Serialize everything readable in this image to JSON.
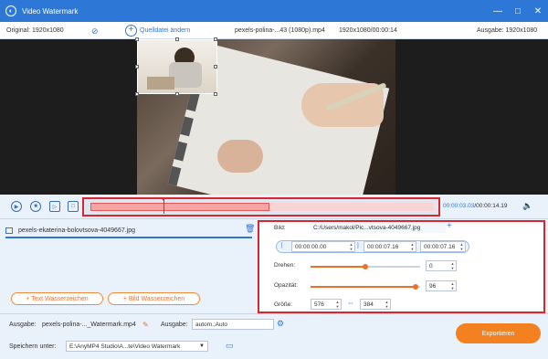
{
  "window": {
    "title": "Video Watermark",
    "controls": [
      "—",
      "□",
      "✕"
    ]
  },
  "info": {
    "original": "Original: 1920x1080",
    "change_source": "Quelldatei ändern",
    "filename": "pexels-polina-...43 (1080p).mp4",
    "res_time": "1920x1080/00:00:14",
    "output": "Ausgabe: 1920x1080"
  },
  "timeline": {
    "current": "00:00:03.03",
    "total": "/00:00:14.19"
  },
  "watermark_list": {
    "items": [
      {
        "name": "pexels-ekaterina-bolovtsova-4049667.jpg"
      }
    ],
    "text_btn": "+ Text Wasserzeichen",
    "image_btn": "+ Bild Wasserzeichen"
  },
  "props": {
    "image_label": "Bild:",
    "image_path": "C:/Users/makol/Pic...vtsova-4049667.jpg",
    "start": "00:00:00.00",
    "end": "00:00:07.16",
    "duration": "00:00:07.16",
    "rotate_label": "Drehen:",
    "rotate_value": "0",
    "rotate_fraction": 0.5,
    "opacity_label": "Opazität:",
    "opacity_value": "96",
    "opacity_fraction": 0.96,
    "size_label": "Größe:",
    "width": "576",
    "height": "384"
  },
  "footer": {
    "output_label": "Ausgabe:",
    "output_value": "pexels-polina-..._Watermark.mp4",
    "output2_label": "Ausgabe:",
    "output2_value": "autom.;Auto",
    "save_label": "Speichern unter:",
    "save_path": "E:\\AnyMP4 Studio\\A...te\\Video Watermark",
    "export": "Exportieren"
  },
  "colors": {
    "accent": "#2d78d6",
    "orange": "#f38120",
    "highlight": "#d9252f"
  }
}
